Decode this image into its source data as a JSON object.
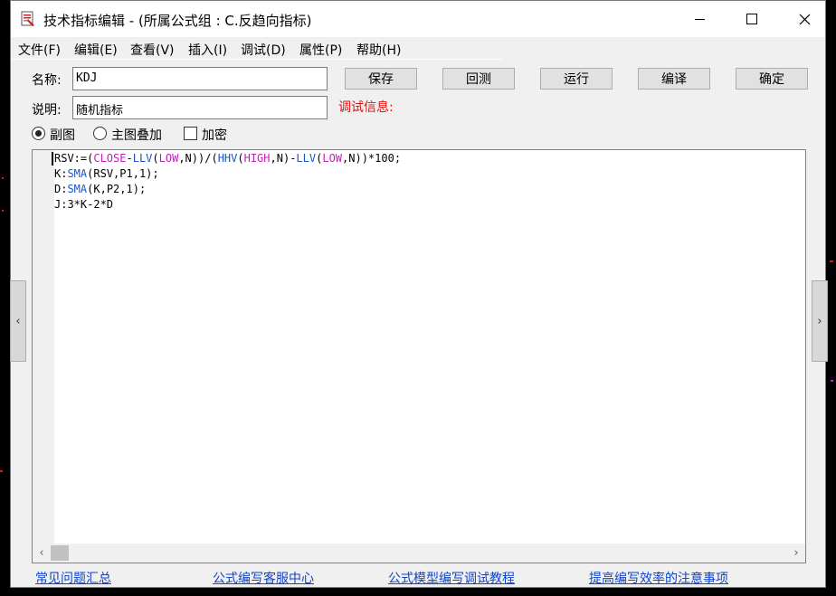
{
  "window": {
    "title": "技术指标编辑 - (所属公式组 : C.反趋向指标)"
  },
  "menu": [
    {
      "label": "文件(F)"
    },
    {
      "label": "编辑(E)"
    },
    {
      "label": "查看(V)"
    },
    {
      "label": "插入(I)"
    },
    {
      "label": "调试(D)"
    },
    {
      "label": "属性(P)"
    },
    {
      "label": "帮助(H)"
    }
  ],
  "form": {
    "name_label": "名称:",
    "name_value": "KDJ",
    "desc_label": "说明:",
    "desc_value": "随机指标",
    "debug_label": "调试信息:"
  },
  "buttons": {
    "save": "保存",
    "backtest": "回测",
    "run": "运行",
    "compile": "编译",
    "ok": "确定"
  },
  "options": {
    "sub_chart": "副图",
    "main_overlay": "主图叠加",
    "encrypt": "加密",
    "selected": "sub_chart",
    "encrypt_checked": false
  },
  "code": {
    "lines": [
      [
        {
          "t": "RSV:=("
        },
        {
          "t": "CLOSE",
          "c": "builtin"
        },
        {
          "t": "-"
        },
        {
          "t": "LLV",
          "c": "fn"
        },
        {
          "t": "("
        },
        {
          "t": "LOW",
          "c": "builtin"
        },
        {
          "t": ",N))/("
        },
        {
          "t": "HHV",
          "c": "fn"
        },
        {
          "t": "("
        },
        {
          "t": "HIGH",
          "c": "builtin"
        },
        {
          "t": ",N)-"
        },
        {
          "t": "LLV",
          "c": "fn"
        },
        {
          "t": "("
        },
        {
          "t": "LOW",
          "c": "builtin"
        },
        {
          "t": ",N))*100;"
        }
      ],
      [
        {
          "t": "K:"
        },
        {
          "t": "SMA",
          "c": "fn"
        },
        {
          "t": "(RSV,P1,1);"
        }
      ],
      [
        {
          "t": "D:"
        },
        {
          "t": "SMA",
          "c": "fn"
        },
        {
          "t": "(K,P2,1);"
        }
      ],
      [
        {
          "t": "J:3*K-2*D"
        }
      ]
    ]
  },
  "links": [
    {
      "label": "常见问题汇总"
    },
    {
      "label": "公式编写客服中心"
    },
    {
      "label": "公式模型编写调试教程"
    },
    {
      "label": "提高编写效率的注意事项"
    }
  ],
  "colors": {
    "function_keyword": "#1a55c8",
    "data_keyword": "#c020b8",
    "debug_text": "#e01010",
    "link": "#1144cc"
  },
  "icons": {
    "app": "formula-editor-icon",
    "minimize": "minimize-icon",
    "maximize": "maximize-icon",
    "close": "close-icon",
    "scroll_left": "chevron-left-icon",
    "scroll_right": "chevron-right-icon"
  }
}
